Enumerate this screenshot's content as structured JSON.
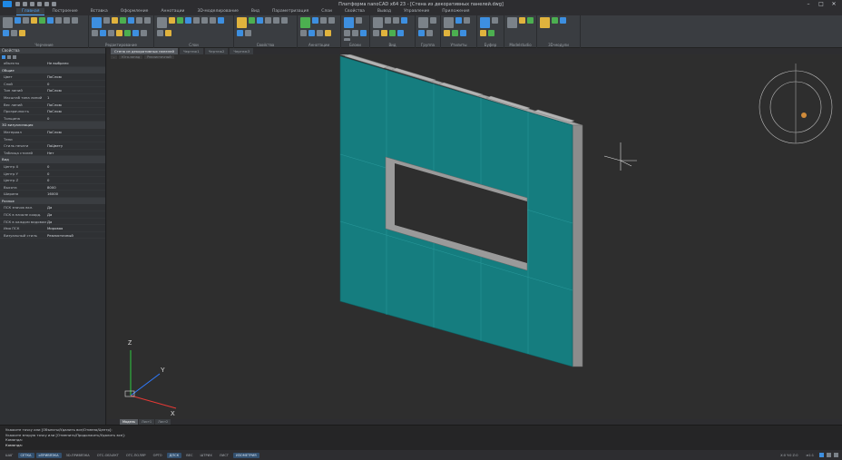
{
  "app": {
    "title": "Платформа nanoCAD x64 23 - [Стена из декоративных панелей.dwg]",
    "quick_access": [
      "new-icon",
      "open-icon",
      "save-icon",
      "undo-icon",
      "redo-icon",
      "print-icon"
    ]
  },
  "menu_tabs": [
    "Главная",
    "Построение",
    "Вставка",
    "Оформление",
    "Аннотации",
    "3D-моделирование",
    "Вид",
    "Параметризация",
    "Слои",
    "Свойства",
    "Вывод",
    "Управление",
    "Приложения"
  ],
  "ribbon_groups": [
    {
      "label": "Черчение",
      "icons": 12
    },
    {
      "label": "Редактирование",
      "icons": 14
    },
    {
      "label": "Слои",
      "icons": 10
    },
    {
      "label": "Свойства",
      "icons": 8
    },
    {
      "label": "Аннотации",
      "icons": 8
    },
    {
      "label": "Блоки",
      "icons": 6
    },
    {
      "label": "Вид",
      "icons": 8
    },
    {
      "label": "Группа",
      "icons": 4
    },
    {
      "label": "Утилиты",
      "icons": 6
    },
    {
      "label": "Буфер",
      "icons": 4
    },
    {
      "label": "Modelstudio",
      "icons": 3
    },
    {
      "label": "3D-модули",
      "icons": 3
    }
  ],
  "ribbon_props": {
    "layer_value": "0",
    "color_value": "ПоСлою",
    "linetype_value": "ПоСлою",
    "lineweight_value": "ПоСлою"
  },
  "properties": {
    "title": "Свойства",
    "selection": "объекты",
    "selection_value": "Не выбрано",
    "sections": [
      {
        "name": "Общие",
        "rows": [
          [
            "Цвет",
            "ПоСлою"
          ],
          [
            "Слой",
            "0"
          ],
          [
            "Тип линий",
            "ПоСлою"
          ],
          [
            "Масштаб типа линий",
            "1"
          ],
          [
            "Вес линий",
            "ПоСлою"
          ],
          [
            "Прозрачность",
            "ПоСлою"
          ],
          [
            "Толщина",
            "0"
          ]
        ]
      },
      {
        "name": "3D визуализация",
        "rows": [
          [
            "Материал",
            "ПоСлою"
          ],
          [
            "Тени",
            ""
          ],
          [
            "Стиль печати",
            "ПоЦвету"
          ],
          [
            "Таблица стилей",
            "Нет"
          ]
        ]
      },
      {
        "name": "Вид",
        "rows": [
          [
            "Центр X",
            "0"
          ],
          [
            "Центр Y",
            "0"
          ],
          [
            "Центр Z",
            "0"
          ],
          [
            "Высота",
            "8000"
          ],
          [
            "Ширина",
            "16000"
          ]
        ]
      },
      {
        "name": "Разное",
        "rows": [
          [
            "ПСК значок вкл.",
            "Да"
          ],
          [
            "ПСК в начале коорд.",
            "Да"
          ],
          [
            "ПСК в каждом видовом",
            "Да"
          ],
          [
            "Имя ПСК",
            "Мировая"
          ],
          [
            "Визуальный стиль",
            "Реалистичный"
          ]
        ]
      }
    ]
  },
  "doc_tabs": [
    "Стена из декоративных панелей",
    "Чертеж1",
    "Чертеж2",
    "Чертеж3"
  ],
  "active_doc_tab": 0,
  "viewport": {
    "labels": [
      "-",
      "Юго-запад",
      "Реалистичный"
    ],
    "ucs_axes": [
      "X",
      "Y",
      "Z"
    ]
  },
  "layout_tabs": [
    "Модель",
    "Лист1",
    "Лист2"
  ],
  "command_lines": [
    "Укажите точку или [Объекты/Удалить все/Отмена/Центр]:",
    "Укажите вторую точку или [Отменить/Продолжить/Удалить все]:",
    "Команда:"
  ],
  "command_prompt": "Команда:",
  "status_buttons": [
    {
      "label": "ШАГ",
      "on": false
    },
    {
      "label": "СЕТКА",
      "on": true
    },
    {
      "label": "оПРИВЯЗКА",
      "on": true
    },
    {
      "label": "3D-ПРИВЯЗКА",
      "on": false
    },
    {
      "label": "ОТС-ОБЪЕКТ",
      "on": false
    },
    {
      "label": "ОТС-ПОЛЯР",
      "on": false
    },
    {
      "label": "ОРТО",
      "on": false
    },
    {
      "label": "ДПСК",
      "on": true
    },
    {
      "label": "ВЕС",
      "on": false
    },
    {
      "label": "ШТРИХ",
      "on": false
    },
    {
      "label": "ЛИСТ",
      "on": false
    },
    {
      "label": "ИЗОМЕТРИЯ",
      "on": true
    }
  ],
  "status_right": {
    "scale": "м1:1",
    "coords": "X:0 Y:0 Z:0"
  },
  "colors": {
    "wall_front": "#157d7f",
    "wall_side": "#8c8c8c",
    "wall_top": "#a6a6a6",
    "accent": "#4fa3f7",
    "viewport_bg": "#2e2e2e"
  }
}
